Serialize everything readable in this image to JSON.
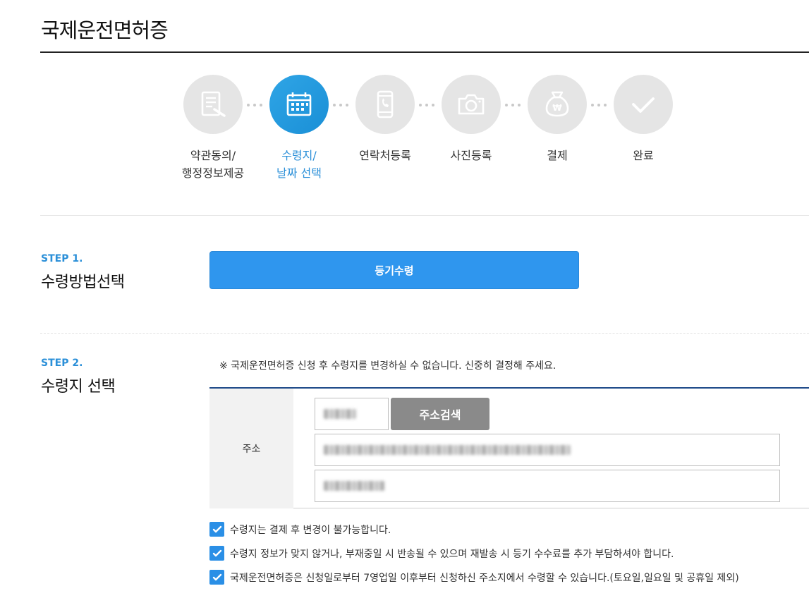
{
  "page": {
    "title": "국제운전면허증"
  },
  "progress": {
    "steps": [
      {
        "icon": "document-pen-icon",
        "line1": "약관동의/",
        "line2": "행정정보제공",
        "active": false
      },
      {
        "icon": "calendar-icon",
        "line1": "수령지/",
        "line2": "날짜 선택",
        "active": true
      },
      {
        "icon": "phone-icon",
        "line1": "연락처등록",
        "line2": "",
        "active": false
      },
      {
        "icon": "camera-icon",
        "line1": "사진등록",
        "line2": "",
        "active": false
      },
      {
        "icon": "money-bag-icon",
        "line1": "결제",
        "line2": "",
        "active": false
      },
      {
        "icon": "checkmark-icon",
        "line1": "완료",
        "line2": "",
        "active": false
      }
    ]
  },
  "step1": {
    "tag": "STEP 1.",
    "heading": "수령방법선택",
    "button_label": "등기수령"
  },
  "step2": {
    "tag": "STEP 2.",
    "heading": "수령지 선택",
    "notice": "※ 국제운전면허증 신청 후 수령지를 변경하실 수 없습니다. 신중히 결정해 주세요.",
    "address": {
      "label": "주소",
      "search_label": "주소검색"
    }
  },
  "agreements": [
    "수령지는 결제 후 변경이 불가능합니다.",
    "수령지 정보가 맞지 않거나, 부재중일 시 반송될 수 있으며 재발송 시 등기 수수료를 추가 부담하셔야 합니다.",
    "국제운전면허증은 신청일로부터 7영업일 이후부터 신청하신 주소지에서 수령할 수 있습니다.(토요일,일요일 및 공휴일 제외)"
  ],
  "colors": {
    "accent": "#2a8fd8",
    "button": "#2f96ee",
    "inactive_circle": "#e5e5e5",
    "table_rule": "#1f4b8a"
  }
}
